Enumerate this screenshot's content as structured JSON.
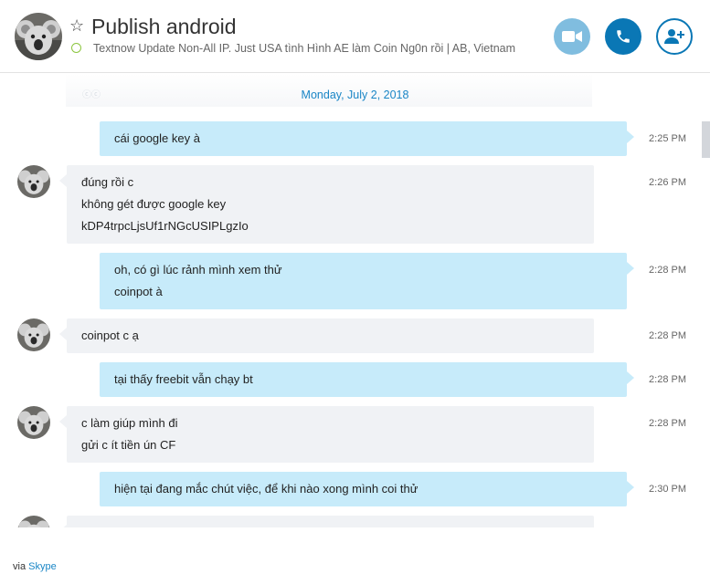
{
  "header": {
    "title": "Publish android",
    "mood": "Textnow Update Non-All IP. Just USA tình Hình AE làm Coin Ng0n rồi  |  AB, Vietnam",
    "icons": {
      "favorite": "star-icon",
      "video": "video-camera-icon",
      "call": "phone-icon",
      "add_people": "add-person-icon"
    },
    "colors": {
      "accent": "#0a77b5",
      "video_button": "#80bddf",
      "presence": "#8cc63f"
    }
  },
  "chat": {
    "ghost_text": "ⓒⓒ",
    "date": "Monday, July 2, 2018",
    "messages": [
      {
        "dir": "out",
        "time": "2:25 PM",
        "lines": [
          "cái google key à"
        ]
      },
      {
        "dir": "in",
        "time": "2:26 PM",
        "lines": [
          "đúng rồi c",
          "không gét được google key",
          "kDP4trpcLjsUf1rNGcUSIPLgzIo"
        ]
      },
      {
        "dir": "out",
        "time": "2:28 PM",
        "lines": [
          "oh, có gì lúc rảnh mình xem thử",
          "coinpot à"
        ]
      },
      {
        "dir": "in",
        "time": "2:28 PM",
        "lines": [
          "coinpot c ạ"
        ]
      },
      {
        "dir": "out",
        "time": "2:28 PM",
        "lines": [
          "tại thấy freebit vẫn chạy bt"
        ]
      },
      {
        "dir": "in",
        "time": "2:28 PM",
        "lines": [
          "c làm giúp mình đi",
          "gửi c ít tiền ún CF"
        ]
      },
      {
        "dir": "out",
        "time": "2:30 PM",
        "lines": [
          "hiện tại đang mắc chút việc, để khi nào xong mình coi thử"
        ]
      },
      {
        "dir": "in",
        "time": "",
        "lines": [
          ""
        ]
      }
    ],
    "colors": {
      "outgoing": "#c7ebfa",
      "incoming": "#f0f2f5",
      "date": "#1a86c6"
    }
  },
  "footer": {
    "prefix": "via",
    "link": "Skype"
  }
}
